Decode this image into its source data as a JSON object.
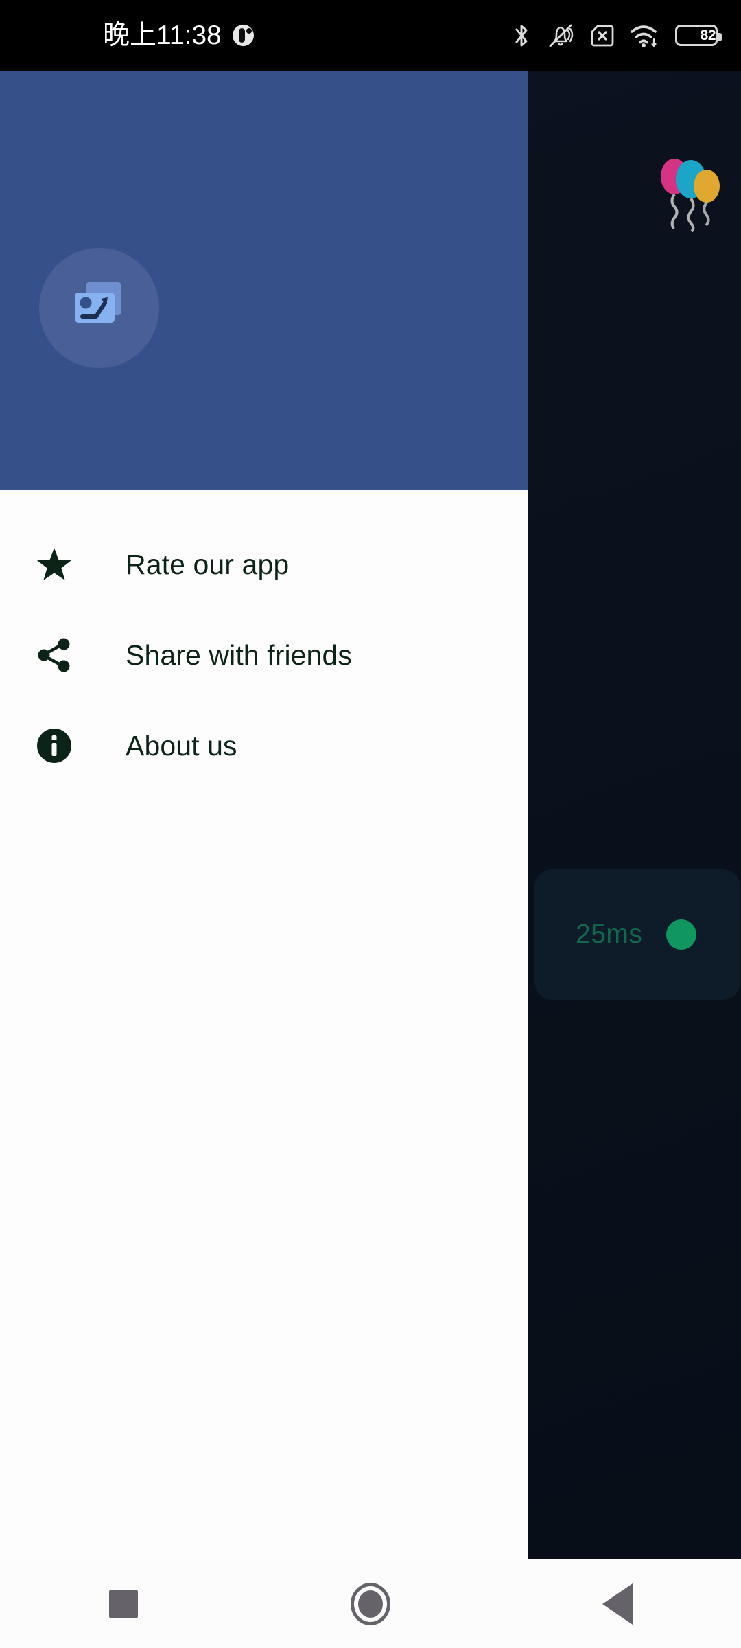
{
  "status_bar": {
    "time": "晚上11:38",
    "app_notification_icon": "app-circle-icon",
    "icons": [
      "bluetooth-icon",
      "ring-off-icon",
      "no-sim-icon",
      "wifi-icon",
      "battery-icon"
    ],
    "battery_level": "82",
    "battery_percent": 82
  },
  "drawer": {
    "header": {
      "logo_icon": "image-gallery-icon",
      "background_color": "#36508a",
      "avatar_background_color": "#4a6398"
    },
    "menu": [
      {
        "icon": "star-icon",
        "label": "Rate our app"
      },
      {
        "icon": "share-icon",
        "label": "Share with friends"
      },
      {
        "icon": "info-circle-icon",
        "label": "About us"
      }
    ]
  },
  "background_app": {
    "balloons_icon": "balloons-icon",
    "balloon_colors": [
      "#d63384",
      "#1ba5c7",
      "#e0a82e"
    ],
    "ping_card": {
      "latency": "25ms",
      "status_dot_color": "#10965f",
      "text_color": "#11694d"
    }
  },
  "nav_bar": {
    "buttons": [
      {
        "name": "recents-button",
        "icon": "square-icon"
      },
      {
        "name": "home-button",
        "icon": "circle-icon"
      },
      {
        "name": "back-button",
        "icon": "triangle-left-icon"
      }
    ]
  }
}
